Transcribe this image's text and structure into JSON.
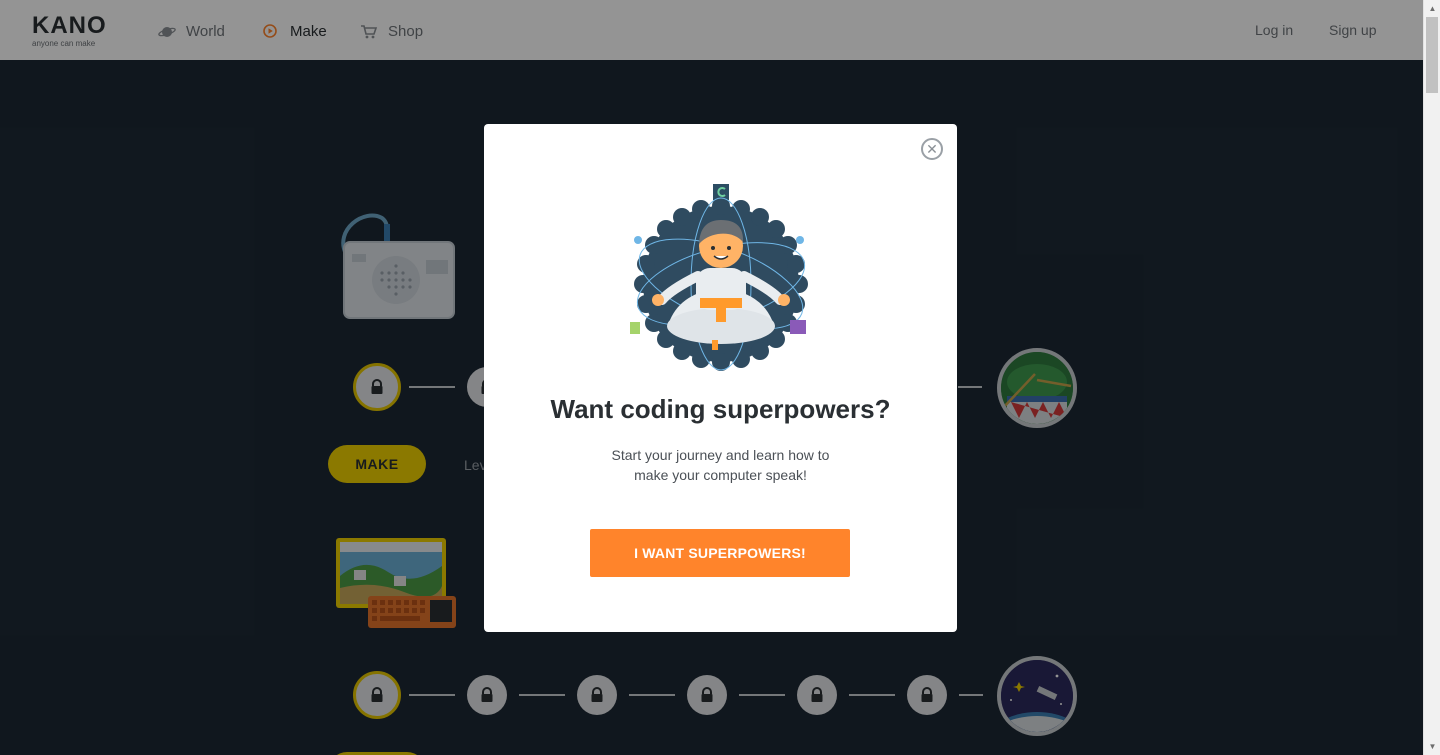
{
  "header": {
    "logo": {
      "word": "KANO",
      "tagline": "anyone can make"
    },
    "nav": [
      {
        "label": "World",
        "icon": "planet-icon"
      },
      {
        "label": "Make",
        "icon": "play-circle-icon",
        "active": true
      },
      {
        "label": "Shop",
        "icon": "cart-icon"
      }
    ],
    "login_label": "Log in",
    "signup_label": "Sign up"
  },
  "page": {
    "make_button_label": "MAKE",
    "level_text": "Lev"
  },
  "modal": {
    "close_icon": "close-icon",
    "hero_icon": "meditating-coder-illustration",
    "title": "Want coding superpowers?",
    "body_line1": "Start your journey and learn how to",
    "body_line2": "make your computer speak!",
    "cta_label": "I WANT SUPERPOWERS!"
  },
  "colors": {
    "accent_orange": "#ff842b",
    "accent_yellow": "#f0d000",
    "page_bg": "#1d2935"
  }
}
